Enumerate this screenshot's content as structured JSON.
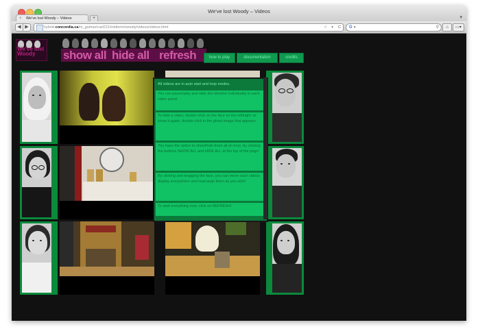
{
  "window": {
    "title": "We've lost Woody – Videos"
  },
  "tabs": [
    {
      "label": "We've lost Woody – Videos",
      "close_label": "×"
    }
  ],
  "tabbar": {
    "new_tab_label": "+",
    "menu_label": "▾"
  },
  "toolbar": {
    "back_icon": "◀",
    "forward_icon": "▶",
    "home_icon": "⌂",
    "display_icon": "▭▾"
  },
  "address": {
    "domain_prefix": "hybrid.",
    "domain": "concordia.ca",
    "path": "/m_guimar/cart211/midterm/woody/videos/videos.html",
    "star": "☆",
    "rss": "▾",
    "reload": "C"
  },
  "search": {
    "engine": "G",
    "caret": "▾",
    "value": "",
    "glass": "⚲"
  },
  "site": {
    "logo_text": "We've lost Woody",
    "buttons": {
      "show_all": "show all",
      "hide_all": "hide all",
      "refresh": "refresh"
    },
    "nav": {
      "how_to_play": "how to play",
      "documentation": "documentation",
      "credits": "credits"
    }
  },
  "info": {
    "heading": "All videos are in auto start and loop modes.",
    "items": [
      "You can pause/play and slide the timeline individually in each video panel.",
      "To hide a video, double-click on the face on the left/right; to show it again, double-click in the ghost image that appears.",
      "You have the option to show/hide them all at once, by clicking the buttons SHOW ALL and HIDE ALL at the top of the page!",
      "By clicking and dragging the face, you can move each videos display everywhere and rearrange them as you wish!",
      "To start everything over, click on REFRESH!"
    ]
  },
  "colors": {
    "page_bg": "#111111",
    "panel_green": "#10c264",
    "accent_pink": "#5c0f44",
    "face_green": "#0b8a3c"
  }
}
